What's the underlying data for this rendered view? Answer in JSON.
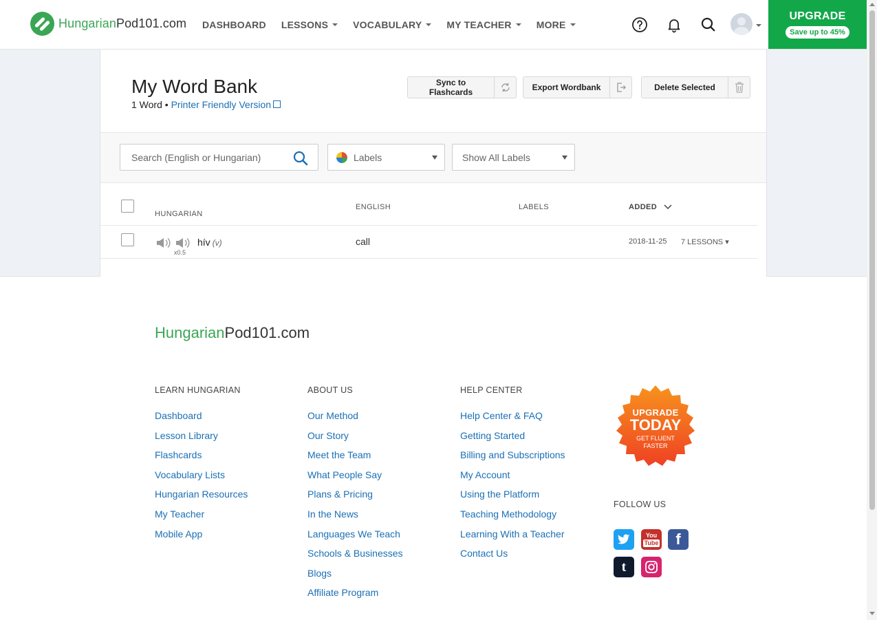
{
  "header": {
    "logo_lang": "Hungarian",
    "logo_pod": "Pod101.com",
    "nav": [
      {
        "label": "DASHBOARD",
        "has_caret": false
      },
      {
        "label": "LESSONS",
        "has_caret": true
      },
      {
        "label": "VOCABULARY",
        "has_caret": true
      },
      {
        "label": "MY TEACHER",
        "has_caret": true
      },
      {
        "label": "MORE",
        "has_caret": true
      }
    ],
    "icons": [
      "help-icon",
      "bell-icon",
      "search-icon",
      "avatar"
    ],
    "upgrade_title": "UPGRADE",
    "upgrade_sub": "Save up to 45%"
  },
  "wordbank": {
    "title": "My Word Bank",
    "count": "1 Word",
    "bullet": "•",
    "printer_link": "Printer Friendly Version",
    "actions": {
      "sync": "Sync to Flashcards",
      "export": "Export Wordbank",
      "delete": "Delete Selected"
    },
    "search_placeholder": "Search (English or Hungarian)",
    "labels_select": "Labels",
    "show_labels_select": "Show All Labels",
    "columns": {
      "hungarian": "HUNGARIAN",
      "english": "ENGLISH",
      "labels": "LABELS",
      "added": "ADDED"
    },
    "rows": [
      {
        "hungarian": "hív",
        "pos": "(v)",
        "speed": "x0.5",
        "english": "call",
        "added": "2018-11-25",
        "lessons": "7 LESSONS ▾"
      }
    ]
  },
  "footer": {
    "logo_lang": "Hungarian",
    "logo_pod": "Pod101.com",
    "columns": [
      {
        "title": "LEARN HUNGARIAN",
        "links": [
          "Dashboard",
          "Lesson Library",
          "Flashcards",
          "Vocabulary Lists",
          "Hungarian Resources",
          "My Teacher",
          "Mobile App"
        ]
      },
      {
        "title": "ABOUT US",
        "links": [
          "Our Method",
          "Our Story",
          "Meet the Team",
          "What People Say",
          "Plans & Pricing",
          "In the News",
          "Languages We Teach",
          "Schools & Businesses",
          "Blogs",
          "Affiliate Program"
        ]
      },
      {
        "title": "HELP CENTER",
        "links": [
          "Help Center & FAQ",
          "Getting Started",
          "Billing and Subscriptions",
          "My Account",
          "Using the Platform",
          "Teaching Methodology",
          "Learning With a Teacher",
          "Contact Us"
        ]
      }
    ],
    "badge": {
      "line1": "UPGRADE",
      "line2": "TODAY",
      "line3": "GET FLUENT",
      "line4": "FASTER"
    },
    "follow_us": "FOLLOW US",
    "social": [
      {
        "name": "twitter",
        "glyph": "t",
        "color": "#1da1f2"
      },
      {
        "name": "youtube",
        "glyph": "You Tube",
        "color": "#d62d20"
      },
      {
        "name": "facebook",
        "glyph": "f",
        "color": "#3b5998"
      },
      {
        "name": "tumblr",
        "glyph": "t",
        "color": "#0f1b2c"
      },
      {
        "name": "instagram",
        "glyph": "◎",
        "color": "#d6246e"
      }
    ]
  },
  "colors": {
    "brand_green": "#3aa655",
    "upgrade_green": "#12a84a",
    "link_blue": "#1a6fb5",
    "badge_orange": "#f26522"
  }
}
